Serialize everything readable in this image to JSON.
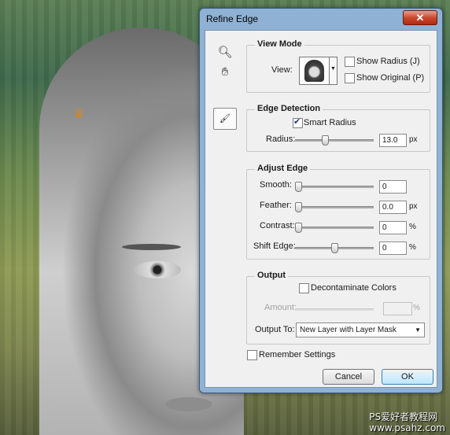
{
  "dialog": {
    "title": "Refine Edge",
    "close_glyph": "✕"
  },
  "view_mode": {
    "title": "View Mode",
    "view_label": "View:",
    "show_radius": "Show Radius (J)",
    "show_original": "Show Original (P)"
  },
  "edge_detection": {
    "title": "Edge Detection",
    "smart_radius": "Smart Radius",
    "radius_label": "Radius:",
    "radius_value": "13.0",
    "radius_unit": "px",
    "radius_level": 0.37
  },
  "adjust_edge": {
    "title": "Adjust Edge",
    "smooth_label": "Smooth:",
    "smooth_value": "0",
    "smooth_level": 0,
    "feather_label": "Feather:",
    "feather_value": "0.0",
    "feather_unit": "px",
    "feather_level": 0,
    "contrast_label": "Contrast:",
    "contrast_value": "0",
    "contrast_unit": "%",
    "contrast_level": 0,
    "shift_label": "Shift Edge:",
    "shift_value": "0",
    "shift_unit": "%",
    "shift_level": 0.5
  },
  "output": {
    "title": "Output",
    "decontaminate": "Decontaminate Colors",
    "amount_label": "Amount:",
    "amount_unit": "%",
    "output_to_label": "Output To:",
    "output_to_value": "New Layer with Layer Mask"
  },
  "remember": "Remember Settings",
  "buttons": {
    "cancel": "Cancel",
    "ok": "OK"
  },
  "watermark": {
    "line1": "PS爱好者教程网",
    "line2": "www.psahz.com"
  }
}
